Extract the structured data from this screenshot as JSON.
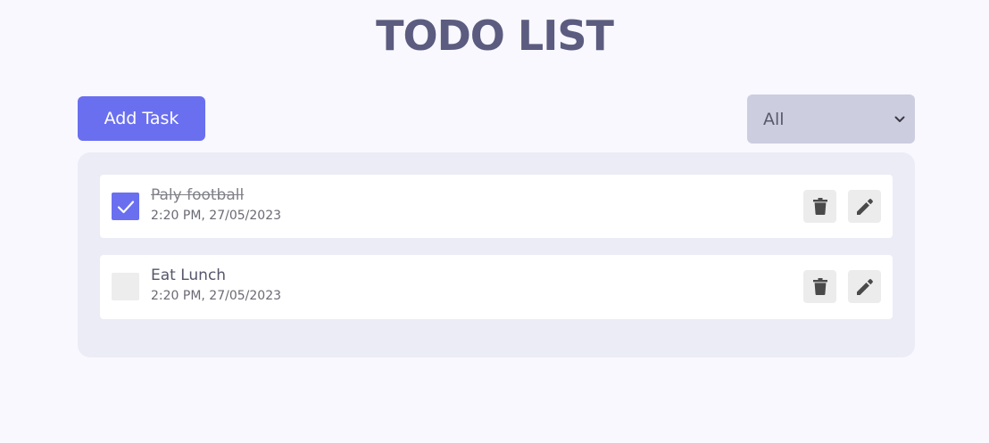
{
  "header": {
    "title": "TODO LIST"
  },
  "toolbar": {
    "add_label": "Add Task",
    "filter_selected": "All"
  },
  "tasks": [
    {
      "title": "Paly football",
      "time": "2:20 PM, 27/05/2023",
      "completed": true
    },
    {
      "title": "Eat Lunch",
      "time": "2:20 PM, 27/05/2023",
      "completed": false
    }
  ],
  "icons": {
    "check": "check-icon",
    "delete": "trash-icon",
    "edit": "pencil-icon",
    "dropdown": "chevron-down-icon"
  },
  "colors": {
    "accent": "#6a6ff0",
    "title": "#5b5c7f",
    "background": "#f8f8fe",
    "panel": "#ececf6",
    "filter_bg": "#cdcde0"
  }
}
